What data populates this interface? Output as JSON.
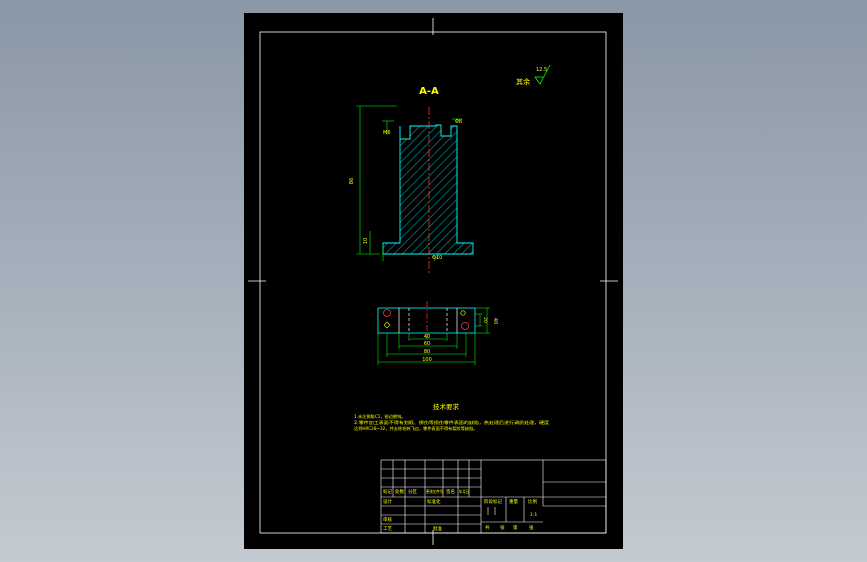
{
  "section_label": "A-A",
  "surface_finish": {
    "label": "其余",
    "value": "12.5"
  },
  "dimensions": {
    "height": "86",
    "bore": "Φ8",
    "base_hole": "Φ10",
    "foot_height": "10",
    "base_width": "100",
    "width_1": "80",
    "width_2": "60",
    "width_3": "40",
    "depth": "40",
    "depth_2": "20",
    "thread": "M6"
  },
  "technical_requirements": {
    "title": "技术要求",
    "lines": [
      "1.未注倒角C1，锐边倒钝。",
      "2.零件加工表面不得有划痕、擦伤等损伤零件表面的缺陷，热处理后进行调质处理，硬度",
      "达到HRC28~32，并去除毛刺飞边，零件表面不得有裂纹等缺陷。"
    ]
  },
  "title_block": {
    "row_labels": [
      "标记",
      "处数",
      "分区",
      "更改文件号",
      "签名",
      "年月日"
    ],
    "designer": "设计",
    "standardization": "标准化",
    "checker": "审核",
    "process": "工艺",
    "approver": "批准",
    "stage_header": [
      "阶段标记",
      "重量",
      "比例"
    ],
    "scale": "1:1",
    "sheet_info": [
      "共",
      "张",
      "第",
      "张"
    ]
  }
}
